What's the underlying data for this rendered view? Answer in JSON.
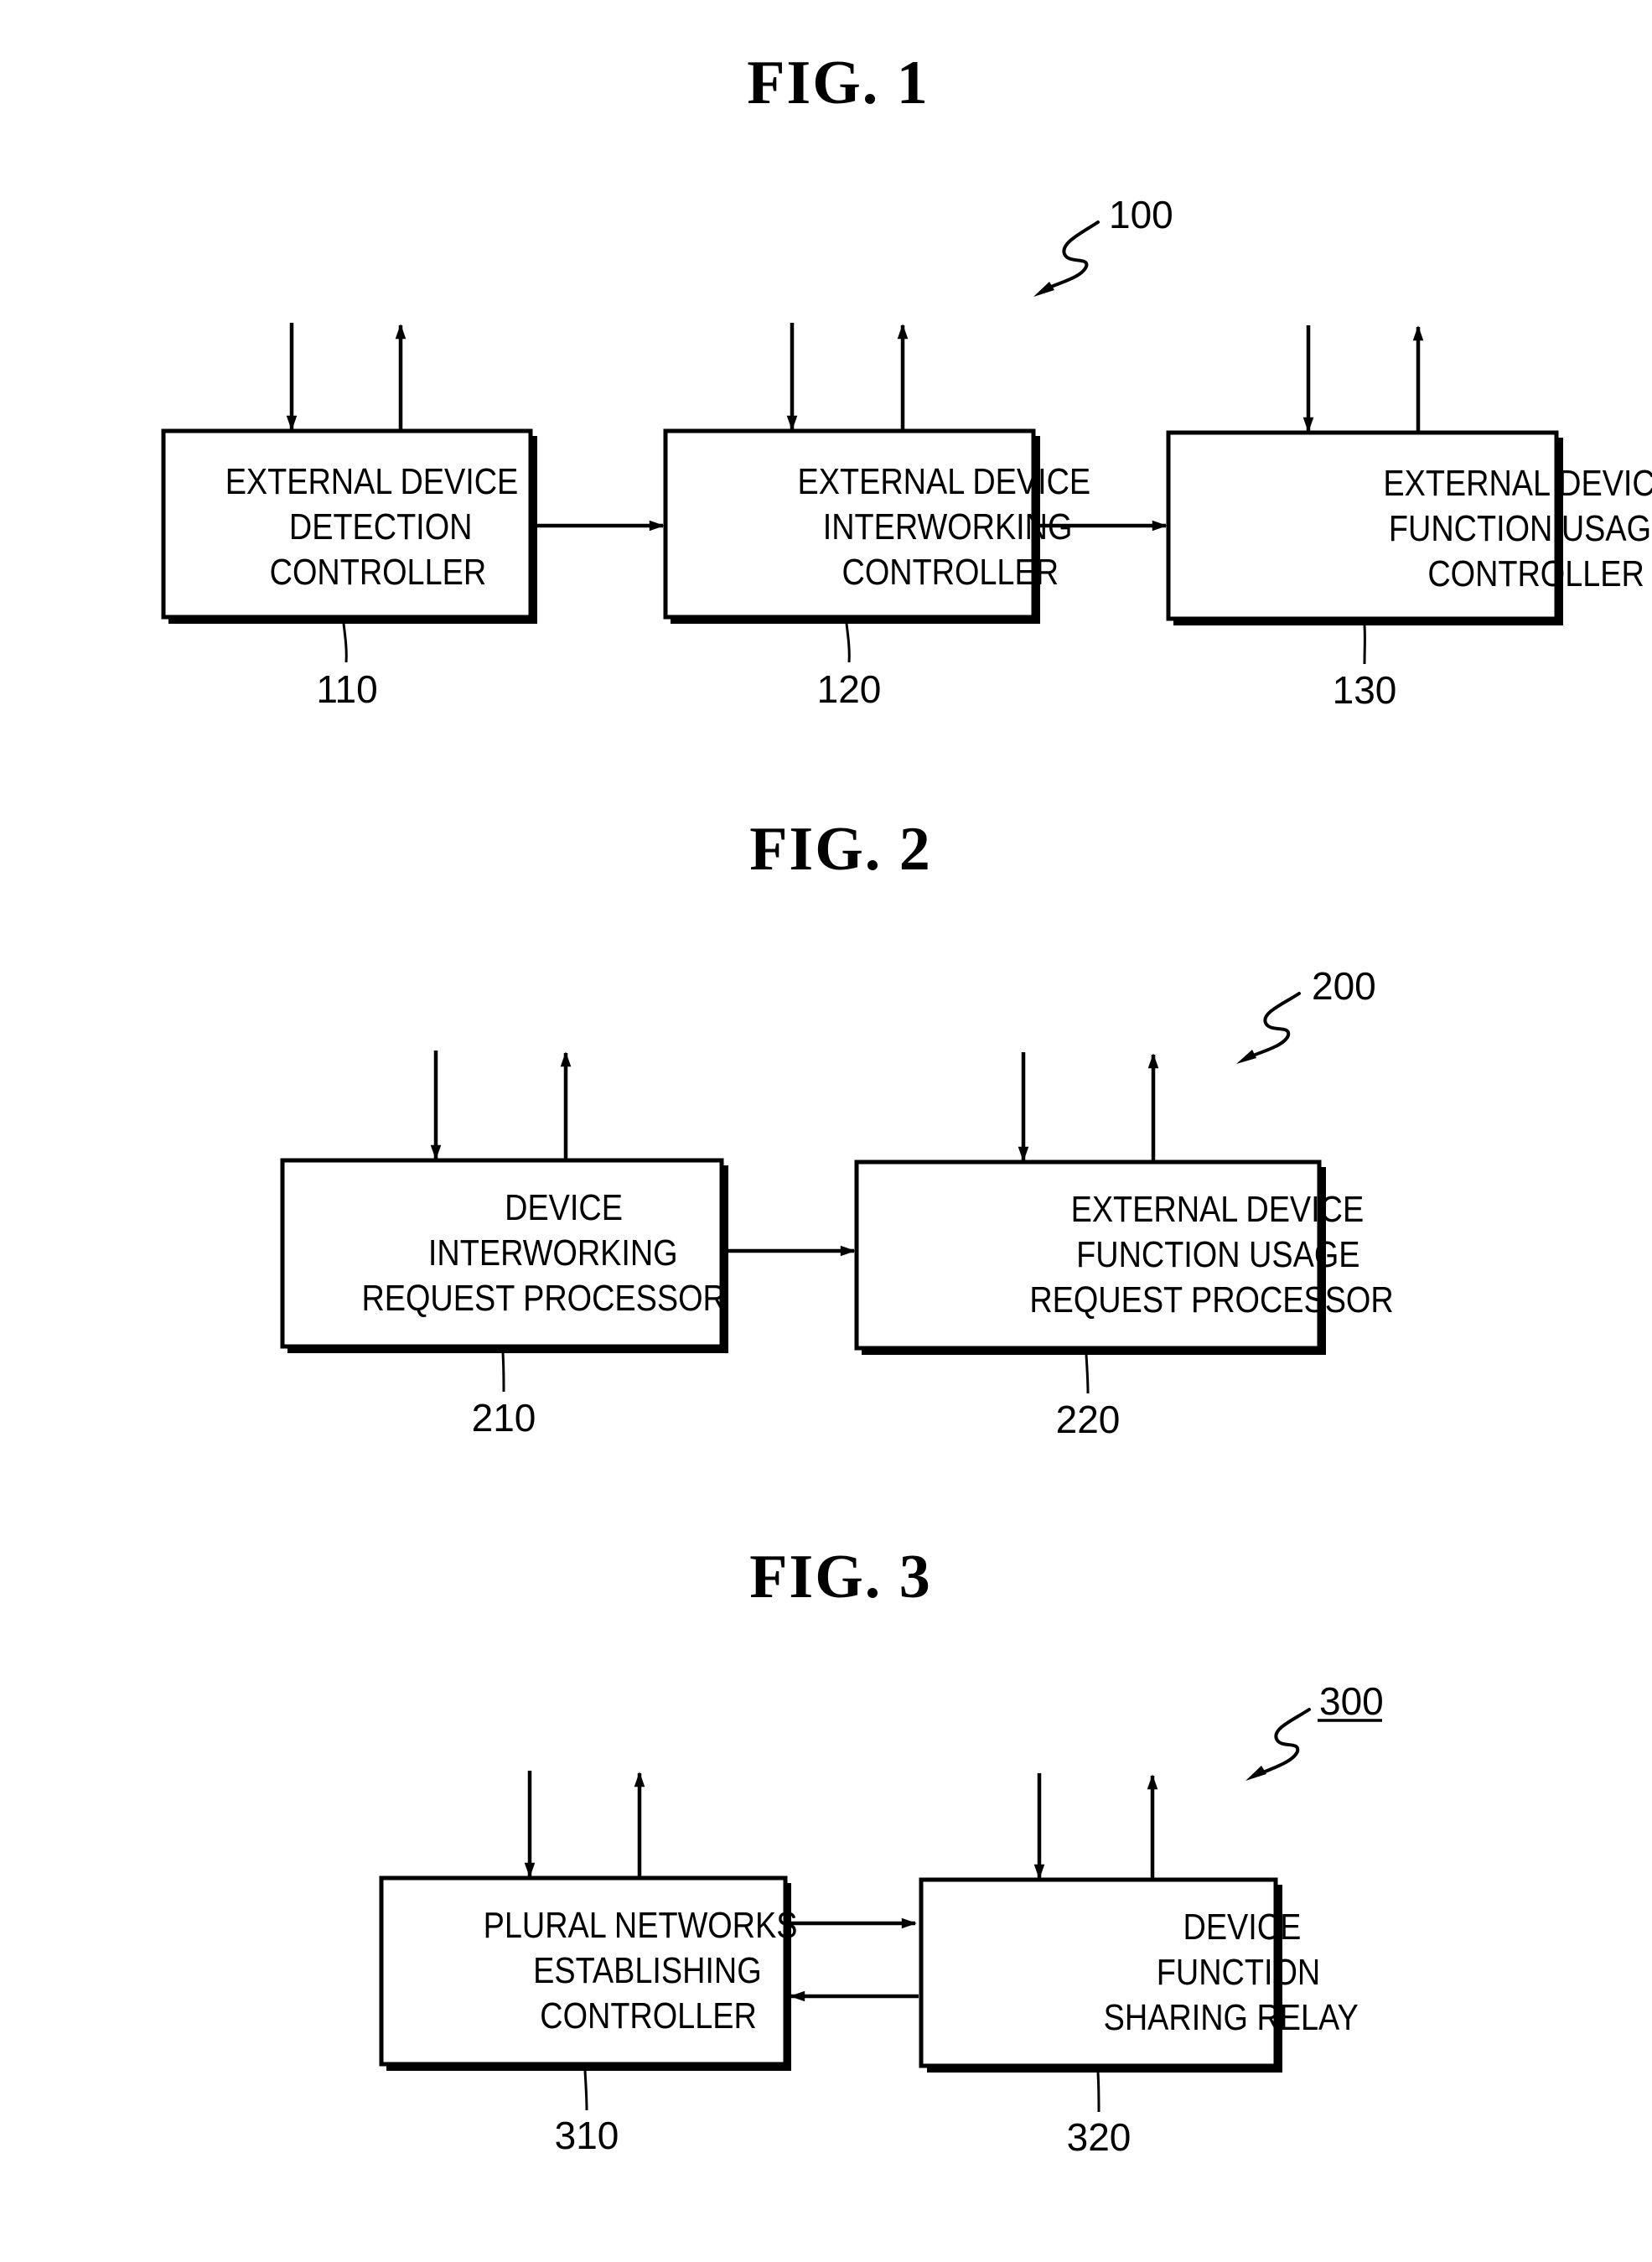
{
  "figures": [
    {
      "title": "FIG.  1",
      "reference": {
        "label": "100",
        "underlined": false
      },
      "blocks": [
        {
          "id": "110",
          "lines": [
            "EXTERNAL DEVICE",
            "DETECTION",
            "CONTROLLER"
          ]
        },
        {
          "id": "120",
          "lines": [
            "EXTERNAL DEVICE",
            "INTERWORKING",
            "CONTROLLER"
          ]
        },
        {
          "id": "130",
          "lines": [
            "EXTERNAL DEVICE",
            "FUNCTION USAGE",
            "CONTROLLER"
          ]
        }
      ],
      "connections": [
        {
          "from": "110",
          "to": "120",
          "direction": "forward"
        },
        {
          "from": "120",
          "to": "130",
          "direction": "forward"
        }
      ],
      "io_arrows": "each block has one input arrow (down) and one output arrow (up)"
    },
    {
      "title": "FIG.  2",
      "reference": {
        "label": "200",
        "underlined": false
      },
      "blocks": [
        {
          "id": "210",
          "lines": [
            "DEVICE",
            "INTERWORKING",
            "REQUEST PROCESSOR"
          ]
        },
        {
          "id": "220",
          "lines": [
            "EXTERNAL DEVICE",
            "FUNCTION USAGE",
            "REQUEST PROCESSOR"
          ]
        }
      ],
      "connections": [
        {
          "from": "210",
          "to": "220",
          "direction": "forward"
        }
      ],
      "io_arrows": "each block has one input arrow (down) and one output arrow (up)"
    },
    {
      "title": "FIG.  3",
      "reference": {
        "label": "300",
        "underlined": true
      },
      "blocks": [
        {
          "id": "310",
          "lines": [
            "PLURAL NETWORKS",
            "ESTABLISHING",
            "CONTROLLER"
          ]
        },
        {
          "id": "320",
          "lines": [
            "DEVICE",
            "FUNCTION",
            "SHARING RELAY"
          ]
        }
      ],
      "connections": [
        {
          "from": "310",
          "to": "320",
          "direction": "forward"
        },
        {
          "from": "320",
          "to": "310",
          "direction": "backward"
        }
      ],
      "io_arrows": "each block has one input arrow (down) and one output arrow (up)"
    }
  ]
}
